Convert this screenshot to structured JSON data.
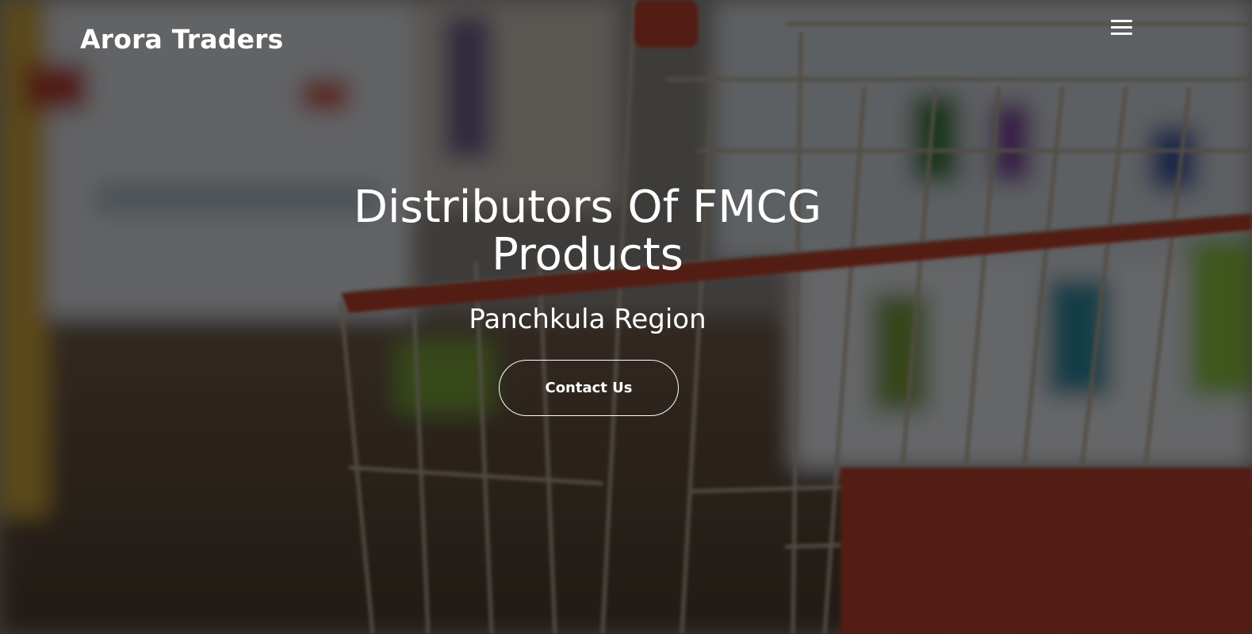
{
  "navbar": {
    "brand": "Arora Traders",
    "menu_icon": "hamburger-menu-icon"
  },
  "hero": {
    "title": "Distributors Of FMCG Products",
    "subtitle": "Panchkula Region",
    "cta_label": "Contact Us",
    "background_image": "shopping-cart-in-supermarket-aisle"
  },
  "colors": {
    "overlay": "#000000",
    "text": "#ffffff",
    "cart_red": "#c23a2a"
  }
}
